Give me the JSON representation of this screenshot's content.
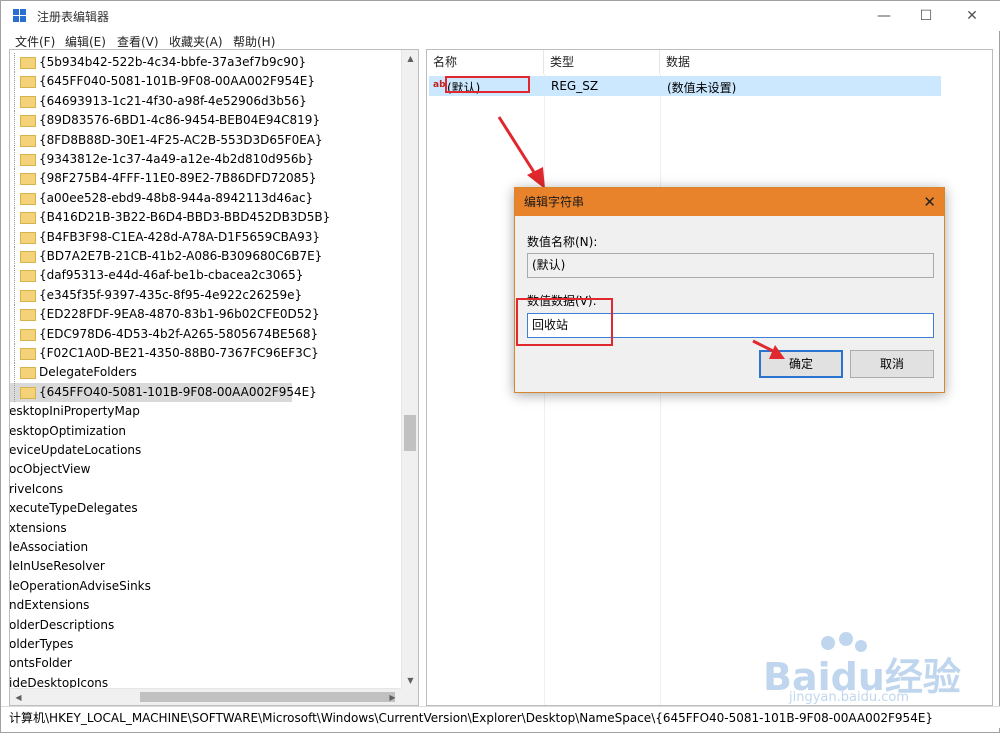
{
  "window": {
    "title": "注册表编辑器",
    "minimize": "—",
    "maximize": "☐",
    "close": "✕"
  },
  "menu": [
    "文件(F)",
    "编辑(E)",
    "查看(V)",
    "收藏夹(A)",
    "帮助(H)"
  ],
  "tree": {
    "keys": [
      "{5b934b42-522b-4c34-bbfe-37a3ef7b9c90}",
      "{645FF040-5081-101B-9F08-00AA002F954E}",
      "{64693913-1c21-4f30-a98f-4e52906d3b56}",
      "{89D83576-6BD1-4c86-9454-BEB04E94C819}",
      "{8FD8B88D-30E1-4F25-AC2B-553D3D65F0EA}",
      "{9343812e-1c37-4a49-a12e-4b2d810d956b}",
      "{98F275B4-4FFF-11E0-89E2-7B86DFD72085}",
      "{a00ee528-ebd9-48b8-944a-8942113d46ac}",
      "{B416D21B-3B22-B6D4-BBD3-BBD452DB3D5B}",
      "{B4FB3F98-C1EA-428d-A78A-D1F5659CBA93}",
      "{BD7A2E7B-21CB-41b2-A086-B309680C6B7E}",
      "{daf95313-e44d-46af-be1b-cbacea2c3065}",
      "{e345f35f-9397-435c-8f95-4e922c26259e}",
      "{ED228FDF-9EA8-4870-83b1-96b02CFE0D52}",
      "{EDC978D6-4D53-4b2f-A265-5805674BE568}",
      "{F02C1A0D-BE21-4350-88B0-7367FC96EF3C}",
      "DelegateFolders",
      "{645FFO40-5081-101B-9F08-00AA002F954E}"
    ],
    "siblings": [
      "esktopIniPropertyMap",
      "esktopOptimization",
      "eviceUpdateLocations",
      "ocObjectView",
      "riveIcons",
      "xecuteTypeDelegates",
      "xtensions",
      "leAssociation",
      "leInUseResolver",
      "leOperationAdviseSinks",
      "ndExtensions",
      "olderDescriptions",
      "olderTypes",
      "ontsFolder",
      "ideDesktopIcons"
    ]
  },
  "list": {
    "columns": [
      "名称",
      "类型",
      "数据"
    ],
    "rows": [
      {
        "icon": "ab",
        "name": "(默认)",
        "type": "REG_SZ",
        "data": "(数值未设置)"
      }
    ]
  },
  "dialog": {
    "title": "编辑字符串",
    "name_label": "数值名称(N):",
    "name_value": "(默认)",
    "data_label": "数值数据(V):",
    "data_value": "回收站",
    "ok": "确定",
    "cancel": "取消",
    "close": "✕"
  },
  "status": "计算机\\HKEY_LOCAL_MACHINE\\SOFTWARE\\Microsoft\\Windows\\CurrentVersion\\Explorer\\Desktop\\NameSpace\\{645FFO40-5081-101B-9F08-00AA002F954E}",
  "watermark": {
    "brand": "Baidu经验",
    "url": "jingyan.baidu.com"
  },
  "colors": {
    "dialog_title": "#e8832b",
    "annotation_red": "#e0282e",
    "selection": "#cce8ff"
  }
}
